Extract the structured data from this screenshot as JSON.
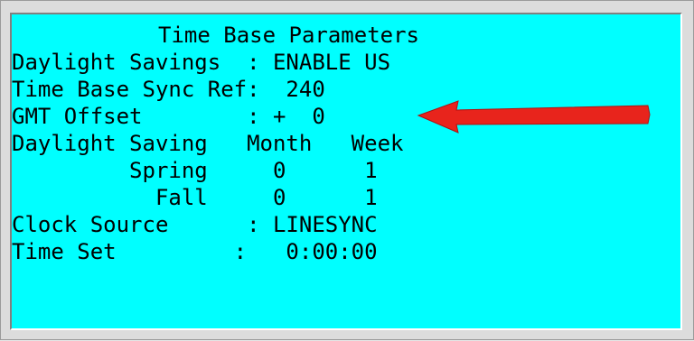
{
  "title": "Time Base Parameters",
  "lines": {
    "daylight_savings": "Daylight Savings  : ENABLE US",
    "sync_ref": "Time Base Sync Ref:  240",
    "gmt_offset": "GMT Offset        : +  0",
    "ds_header": "Daylight Saving   Month   Week",
    "spring": "         Spring     0      1",
    "fall": "           Fall     0      1",
    "clock_source": "Clock Source      : LINESYNC",
    "time_set": "Time Set         :   0:00:00"
  },
  "colors": {
    "screen_background": "#00ffff",
    "arrow": "#e8241c"
  },
  "annotation": {
    "icon": "arrow-left-icon",
    "points_to": "gmt_offset"
  }
}
